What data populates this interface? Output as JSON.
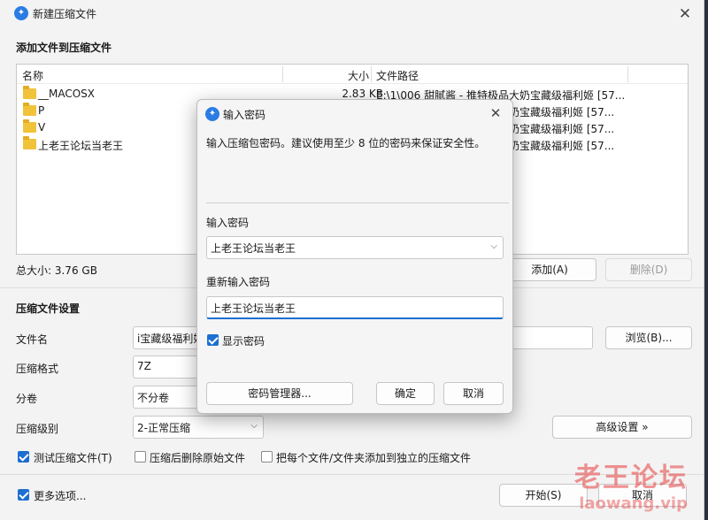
{
  "window": {
    "title": "新建压缩文件",
    "close_glyph": "✕"
  },
  "files_section": {
    "heading": "添加文件到压缩文件",
    "columns": {
      "name": "名称",
      "size": "大小",
      "path": "文件路径"
    },
    "rows": [
      {
        "name": "__MACOSX",
        "size": "2.83 KB",
        "path": "E:\\1\\006 甜腻酱 - 推特极品大奶宝藏级福利姬 [57..."
      },
      {
        "name": "P",
        "size": "",
        "path": "奶宝藏级福利姬 [57..."
      },
      {
        "name": "V",
        "size": "",
        "path": "奶宝藏级福利姬 [57..."
      },
      {
        "name": "上老王论坛当老王",
        "size": "",
        "path": "奶宝藏级福利姬 [57..."
      }
    ],
    "total_size": "总大小: 3.76 GB",
    "add_button": "添加(A)",
    "delete_button": "删除(D)"
  },
  "settings": {
    "heading": "压缩文件设置",
    "filename_label": "文件名",
    "filename_value": "i宝藏级福利姬",
    "browse_button": "浏览(B)...",
    "format_label": "压缩格式",
    "format_value": "7Z",
    "volume_label": "分卷",
    "volume_value": "不分卷",
    "level_label": "压缩级别",
    "level_value": "2-正常压缩",
    "advanced_button": "高级设置 »",
    "test_checkbox": {
      "label": "测试压缩文件(T)",
      "checked": true
    },
    "delete_after_checkbox": {
      "label": "压缩后删除原始文件",
      "checked": false
    },
    "separate_checkbox": {
      "label": "把每个文件/文件夹添加到独立的压缩文件",
      "checked": false
    }
  },
  "footer": {
    "more_options": {
      "label": "更多选项...",
      "checked": true
    },
    "start_button": "开始(S)",
    "cancel_button": "取消"
  },
  "dialog": {
    "title": "输入密码",
    "close_glyph": "✕",
    "description": "输入压缩包密码。建议使用至少 8 位的密码来保证安全性。",
    "password_label": "输入密码",
    "password_value": "上老王论坛当老王",
    "confirm_label": "重新输入密码",
    "confirm_value": "上老王论坛当老王",
    "show_password": {
      "label": "显示密码",
      "checked": true
    },
    "manager_button": "密码管理器...",
    "ok_button": "确定",
    "cancel_button": "取消"
  },
  "watermark": {
    "cn": "老王论坛",
    "en": "laowang.vip"
  },
  "colors": {
    "accent": "#1d6fd1",
    "folder": "#f1c33b",
    "watermark": "#e63c3c"
  },
  "icons": {
    "app": "app-logo-icon",
    "folder": "folder-icon",
    "dropdown": "chevron-down-icon"
  }
}
